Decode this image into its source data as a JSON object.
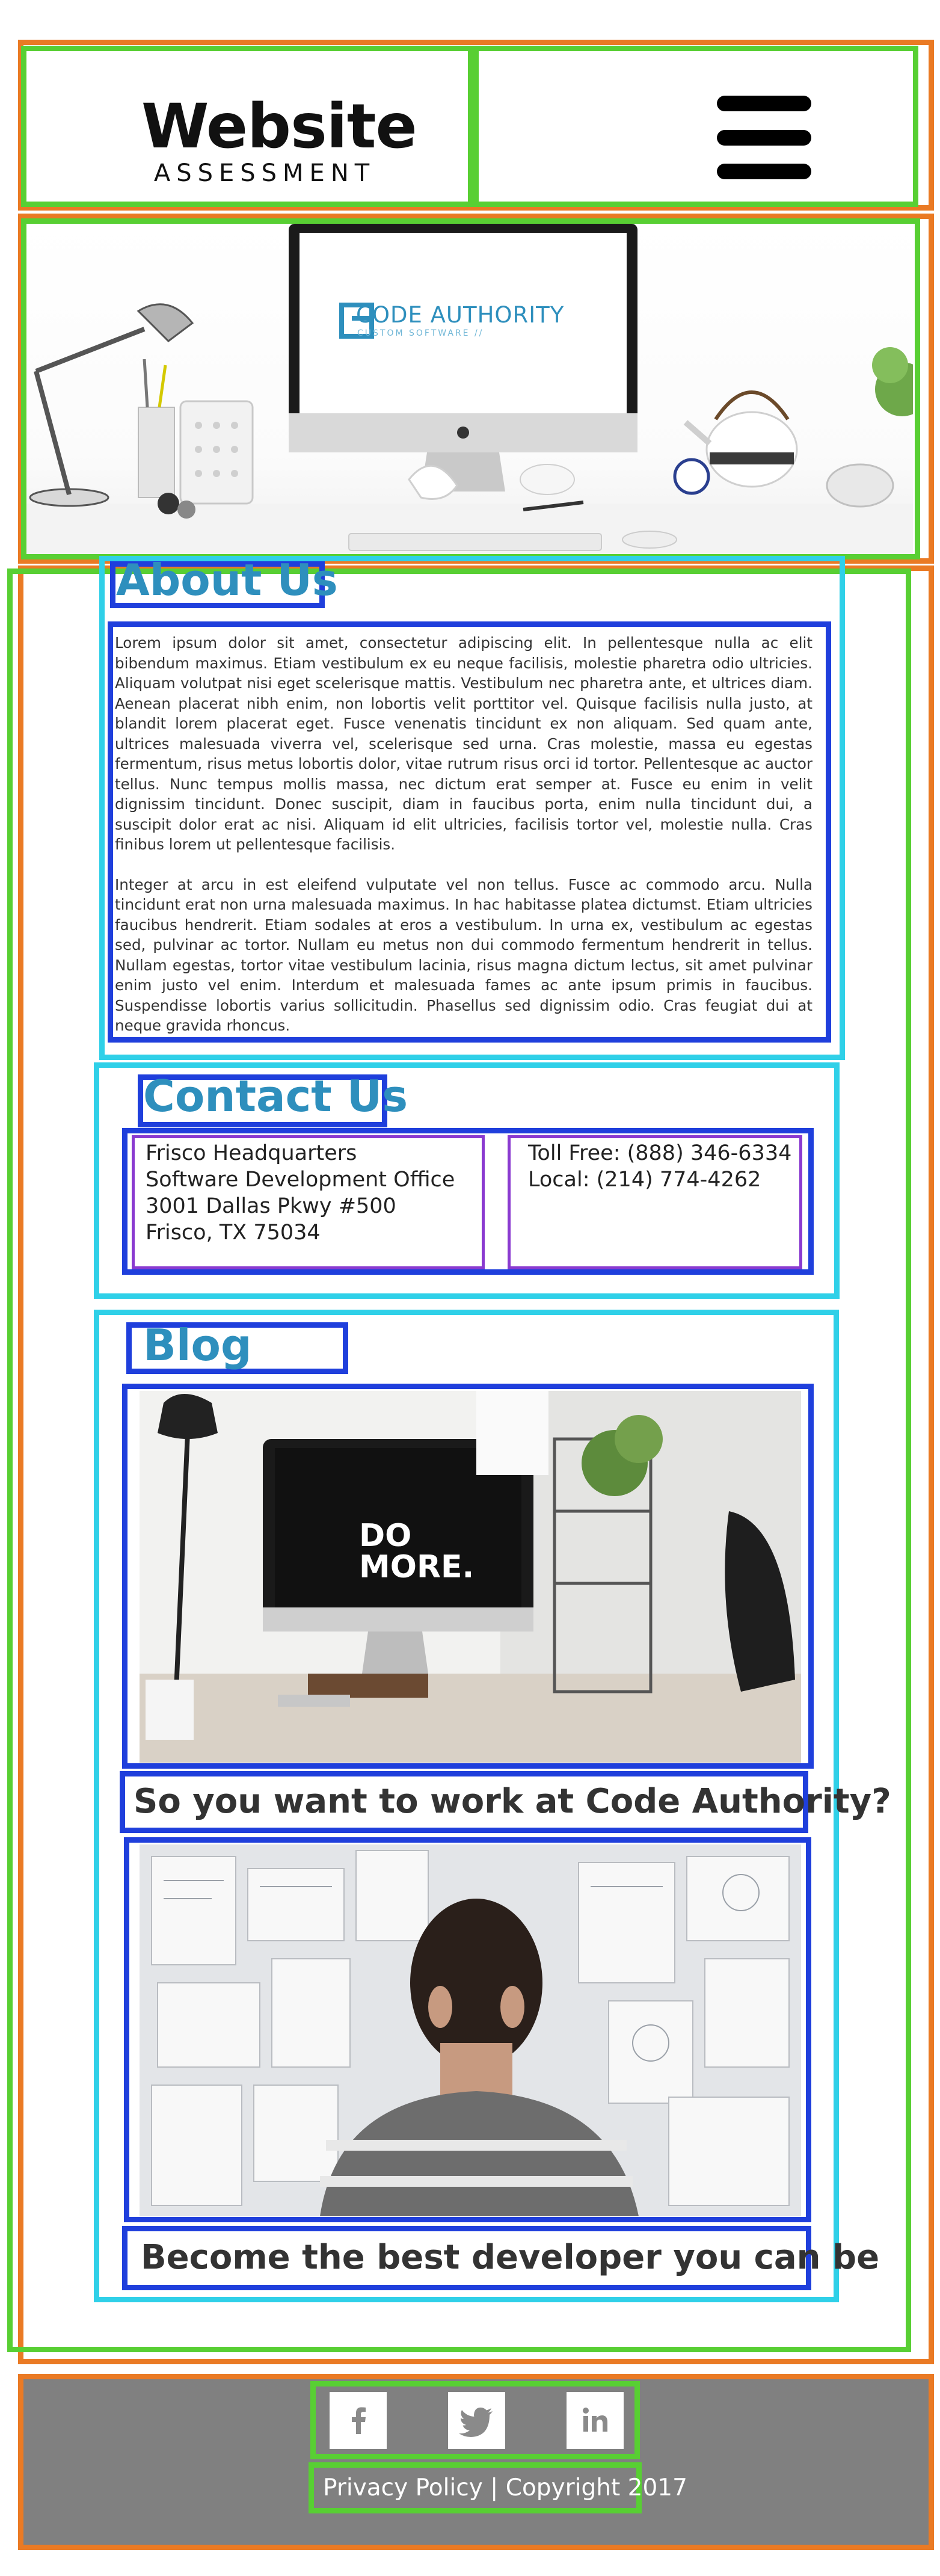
{
  "header": {
    "logo_title": "Website",
    "logo_subtitle": "ASSESSMENT",
    "menu_icon": "hamburger-menu-icon"
  },
  "hero": {
    "brand_name": "CODE AUTHORITY",
    "brand_tagline": "CUSTOM SOFTWARE //"
  },
  "about": {
    "heading": "About Us",
    "paragraph_1": "Lorem ipsum dolor sit amet, consectetur adipiscing elit. In pellentesque nulla ac elit bibendum maximus. Etiam vestibulum ex eu neque facilisis, molestie pharetra odio ultricies. Aliquam volutpat nisi eget scelerisque mattis. Vestibulum nec pharetra ante, et ultrices diam. Aenean placerat nibh enim, non lobortis velit porttitor vel. Quisque facilisis nulla justo, at blandit lorem placerat eget. Fusce venenatis tincidunt ex non aliquam. Sed quam ante, ultrices malesuada viverra vel, scelerisque sed urna. Cras molestie, massa eu egestas fermentum, risus metus lobortis dolor, vitae rutrum risus orci id tortor. Pellentesque ac auctor tellus. Nunc tempus mollis massa, nec dictum erat semper at. Fusce eu enim in velit dignissim tincidunt. Donec suscipit, diam in faucibus porta, enim nulla tincidunt dui, a suscipit dolor erat ac nisi. Aliquam id elit ultricies, facilisis tortor vel, molestie nulla. Cras finibus lorem ut pellentesque facilisis.",
    "paragraph_2": "Integer at arcu in est eleifend vulputate vel non tellus. Fusce ac commodo arcu. Nulla tincidunt erat non urna malesuada maximus. In hac habitasse platea dictumst. Etiam ultricies faucibus hendrerit. Etiam sodales at eros a vestibulum. In urna ex, vestibulum ac egestas sed, pulvinar ac tortor. Nullam eu metus non dui commodo fermentum hendrerit in tellus. Nullam egestas, tortor vitae vestibulum lacinia, risus magna dictum lectus, sit amet pulvinar enim justo vel enim. Interdum et malesuada fames ac ante ipsum primis in faucibus. Suspendisse lobortis varius sollicitudin. Phasellus sed dignissim odio. Cras feugiat dui at neque gravida rhoncus."
  },
  "contact": {
    "heading": "Contact Us",
    "address": "Frisco Headquarters\nSoftware Development Office\n3001 Dallas Pkwy #500\nFrisco, TX 75034",
    "phones": "Toll Free: (888) 346-6334\nLocal: (214) 774-4262"
  },
  "blog": {
    "heading": "Blog",
    "posts": [
      {
        "title": "So you want to work at Code Authority?",
        "screen_text_1": "DO",
        "screen_text_2": "MORE."
      },
      {
        "title": "Become the best developer you can be"
      }
    ]
  },
  "footer": {
    "social_icons": [
      "facebook-icon",
      "twitter-icon",
      "linkedin-icon"
    ],
    "legal": "Privacy Policy | Copyright 2017"
  },
  "colors": {
    "wireframe_orange": "#ea7a24",
    "wireframe_green": "#58cf33",
    "wireframe_cyan": "#2fd0e8",
    "wireframe_blue": "#1f3fdc",
    "wireframe_purple": "#8a3ad0",
    "heading_blue": "#2e8fbd",
    "footer_gray": "#808080"
  }
}
